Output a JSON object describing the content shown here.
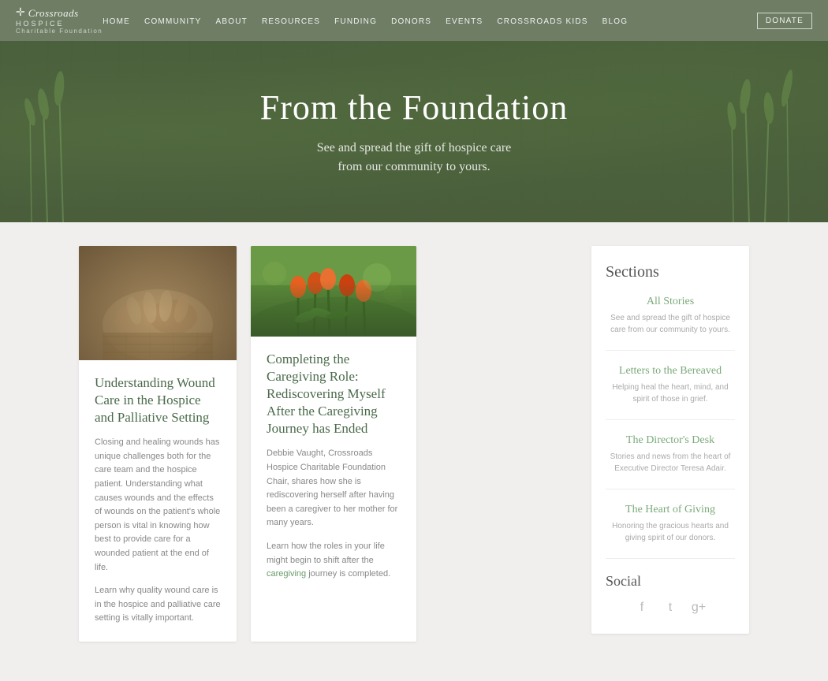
{
  "nav": {
    "logo_main": "Crossroads",
    "logo_hospice": "HOSPICE",
    "logo_sub": "Charitable Foundation",
    "links": [
      {
        "label": "HOME",
        "href": "#"
      },
      {
        "label": "COMMUNITY",
        "href": "#"
      },
      {
        "label": "ABOUT",
        "href": "#"
      },
      {
        "label": "RESOURCES",
        "href": "#"
      },
      {
        "label": "FUNDING",
        "href": "#"
      },
      {
        "label": "DONORS",
        "href": "#"
      },
      {
        "label": "EVENTS",
        "href": "#"
      },
      {
        "label": "CROSSROADS KIDS",
        "href": "#"
      },
      {
        "label": "BLOG",
        "href": "#"
      }
    ],
    "donate_label": "DONATE"
  },
  "hero": {
    "title": "From the Foundation",
    "subtitle_line1": "See and spread the gift of hospice care",
    "subtitle_line2": "from our community to yours."
  },
  "card1": {
    "title": "Understanding Wound Care in the Hospice and Palliative Setting",
    "body": "Closing and healing wounds has unique challenges both for the care team and the hospice patient. Understanding what causes wounds and the effects of wounds on the patient's whole person is vital in knowing how best to provide care for a wounded patient at the end of life.",
    "link_text": "Learn why quality wound care is in the hospice and palliative care setting is vitally important."
  },
  "card2": {
    "title": "Completing the Caregiving Role: Rediscovering Myself After the Caregiving Journey has Ended",
    "body": "Debbie Vaught, Crossroads Hospice Charitable Foundation Chair, shares how she is rediscovering herself after having been a caregiver to her mother for many years.",
    "link_text": "Learn how the roles in your life might begin to shift after the caregiving journey is completed.",
    "link_anchor": "caregiving"
  },
  "sidebar": {
    "title": "Sections",
    "sections": [
      {
        "title": "All Stories",
        "desc": "See and spread the gift of hospice care from our community to yours."
      },
      {
        "title": "Letters to the Bereaved",
        "desc": "Helping heal the heart, mind, and spirit of those in grief."
      },
      {
        "title": "The Director's Desk",
        "desc": "Stories and news from the heart of Executive Director Teresa Adair."
      },
      {
        "title": "The Heart of Giving",
        "desc": "Honoring the gracious hearts and giving spirit of our donors."
      }
    ],
    "social_title": "Social",
    "social_icons": [
      "f",
      "t",
      "g+"
    ]
  }
}
